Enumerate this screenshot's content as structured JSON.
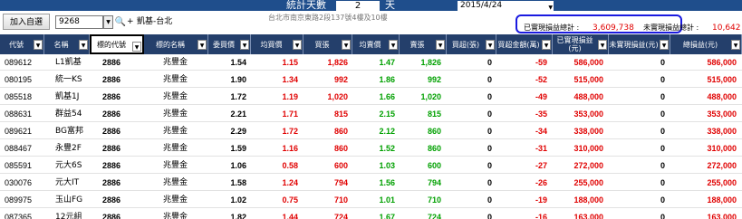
{
  "topbar": {
    "days_label": "統計天數",
    "days_value": "2",
    "days_unit": "天",
    "date_value": "2015/4/24"
  },
  "toolbar": {
    "add_label": "加入自選",
    "code_value": "9268",
    "dropdown_icon": "chevron-down-icon",
    "search_icon": "search-icon",
    "plus_icon": "plus-icon",
    "stock_name": "凱基-台北",
    "address": "台北市南京東路2段137號4樓及10樓",
    "realized_label": "已實現損益總計 :",
    "realized_value": "3,609,738",
    "unrealized_label": "未實現損益總計 :",
    "unrealized_value": "10,642"
  },
  "columns": [
    "代號",
    "名稱",
    "標的代號",
    "標的名稱",
    "委買價",
    "均買價",
    "買張",
    "均賣價",
    "賣張",
    "買超(張)",
    "買超金額(萬)",
    "已實現損益(元)",
    "未實現損益(元)",
    "總損益(元)"
  ],
  "rows": [
    {
      "code": "089612",
      "name": "L1凱基",
      "und": "2886",
      "undname": "兆豐金",
      "bid": "1.54",
      "avgbuy": "1.15",
      "buy": "1,826",
      "avgsell": "1.47",
      "sell": "1,826",
      "net": "0",
      "netamt": "-59",
      "realized": "586,000",
      "unreal": "0",
      "total": "586,000"
    },
    {
      "code": "080195",
      "name": "統一KS",
      "und": "2886",
      "undname": "兆豐金",
      "bid": "1.90",
      "avgbuy": "1.34",
      "buy": "992",
      "avgsell": "1.86",
      "sell": "992",
      "net": "0",
      "netamt": "-52",
      "realized": "515,000",
      "unreal": "0",
      "total": "515,000"
    },
    {
      "code": "085518",
      "name": "凱基1J",
      "und": "2886",
      "undname": "兆豐金",
      "bid": "1.72",
      "avgbuy": "1.19",
      "buy": "1,020",
      "avgsell": "1.66",
      "sell": "1,020",
      "net": "0",
      "netamt": "-49",
      "realized": "488,000",
      "unreal": "0",
      "total": "488,000"
    },
    {
      "code": "088631",
      "name": "群益54",
      "und": "2886",
      "undname": "兆豐金",
      "bid": "2.21",
      "avgbuy": "1.71",
      "buy": "815",
      "avgsell": "2.15",
      "sell": "815",
      "net": "0",
      "netamt": "-35",
      "realized": "353,000",
      "unreal": "0",
      "total": "353,000"
    },
    {
      "code": "089621",
      "name": "BG富邦",
      "und": "2886",
      "undname": "兆豐金",
      "bid": "2.29",
      "avgbuy": "1.72",
      "buy": "860",
      "avgsell": "2.12",
      "sell": "860",
      "net": "0",
      "netamt": "-34",
      "realized": "338,000",
      "unreal": "0",
      "total": "338,000"
    },
    {
      "code": "088467",
      "name": "永豐2F",
      "und": "2886",
      "undname": "兆豐金",
      "bid": "1.59",
      "avgbuy": "1.16",
      "buy": "860",
      "avgsell": "1.52",
      "sell": "860",
      "net": "0",
      "netamt": "-31",
      "realized": "310,000",
      "unreal": "0",
      "total": "310,000"
    },
    {
      "code": "085591",
      "name": "元大6S",
      "und": "2886",
      "undname": "兆豐金",
      "bid": "1.06",
      "avgbuy": "0.58",
      "buy": "600",
      "avgsell": "1.03",
      "sell": "600",
      "net": "0",
      "netamt": "-27",
      "realized": "272,000",
      "unreal": "0",
      "total": "272,000"
    },
    {
      "code": "030076",
      "name": "元大IT",
      "und": "2886",
      "undname": "兆豐金",
      "bid": "1.58",
      "avgbuy": "1.24",
      "buy": "794",
      "avgsell": "1.56",
      "sell": "794",
      "net": "0",
      "netamt": "-26",
      "realized": "255,000",
      "unreal": "0",
      "total": "255,000"
    },
    {
      "code": "089975",
      "name": "玉山FG",
      "und": "2886",
      "undname": "兆豐金",
      "bid": "1.02",
      "avgbuy": "0.75",
      "buy": "710",
      "avgsell": "1.01",
      "sell": "710",
      "net": "0",
      "netamt": "-19",
      "realized": "188,000",
      "unreal": "0",
      "total": "188,000"
    },
    {
      "code": "087365",
      "name": "12元組",
      "und": "2886",
      "undname": "兆豐金",
      "bid": "1.82",
      "avgbuy": "1.44",
      "buy": "724",
      "avgsell": "1.67",
      "sell": "724",
      "net": "0",
      "netamt": "-16",
      "realized": "163,000",
      "unreal": "0",
      "total": "163,000"
    }
  ],
  "colors": {
    "header_bg": "#243f6b",
    "topbar_bg": "#1f4e8c",
    "up": "#e00000",
    "down": "#00a000",
    "highlight_border": "#1a1ae0"
  }
}
